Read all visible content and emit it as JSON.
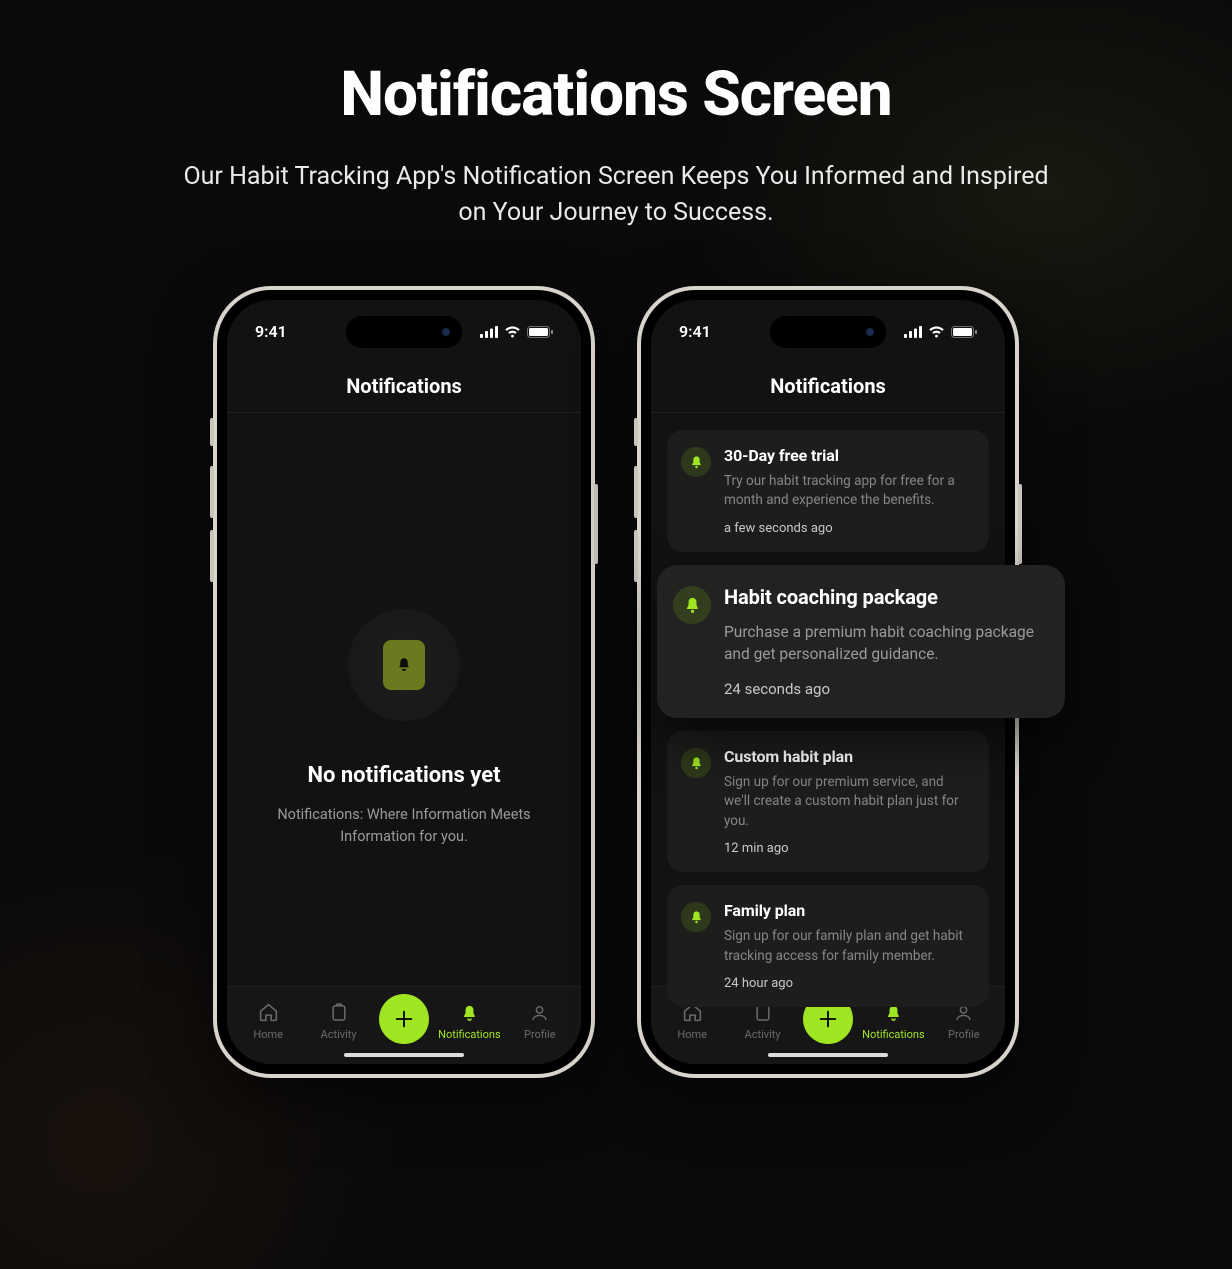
{
  "page": {
    "title": "Notifications Screen",
    "subtitle": "Our Habit Tracking App's Notification Screen Keeps You Informed and Inspired on Your Journey to Success."
  },
  "status": {
    "time": "9:41"
  },
  "screen": {
    "header": "Notifications"
  },
  "empty": {
    "title": "No notifications yet",
    "text": "Notifications: Where Information Meets Information for you."
  },
  "notifications": [
    {
      "title": "30-Day free trial",
      "desc": "Try our habit tracking app for free for a month and experience the benefits.",
      "time": "a few seconds ago",
      "highlighted": false
    },
    {
      "title": "Habit coaching package",
      "desc": "Purchase a premium habit coaching package and get personalized guidance.",
      "time": "24 seconds ago",
      "highlighted": true
    },
    {
      "title": "Custom habit plan",
      "desc": "Sign up for our premium service, and we'll create a custom habit plan just for you.",
      "time": "12 min ago",
      "highlighted": false
    },
    {
      "title": "Family plan",
      "desc": "Sign up for our family plan and get habit tracking access for family member.",
      "time": "24 hour ago",
      "highlighted": false
    }
  ],
  "tabs": {
    "home": "Home",
    "activity": "Activity",
    "notifications": "Notifications",
    "profile": "Profile"
  },
  "colors": {
    "accent": "#9fe521"
  }
}
